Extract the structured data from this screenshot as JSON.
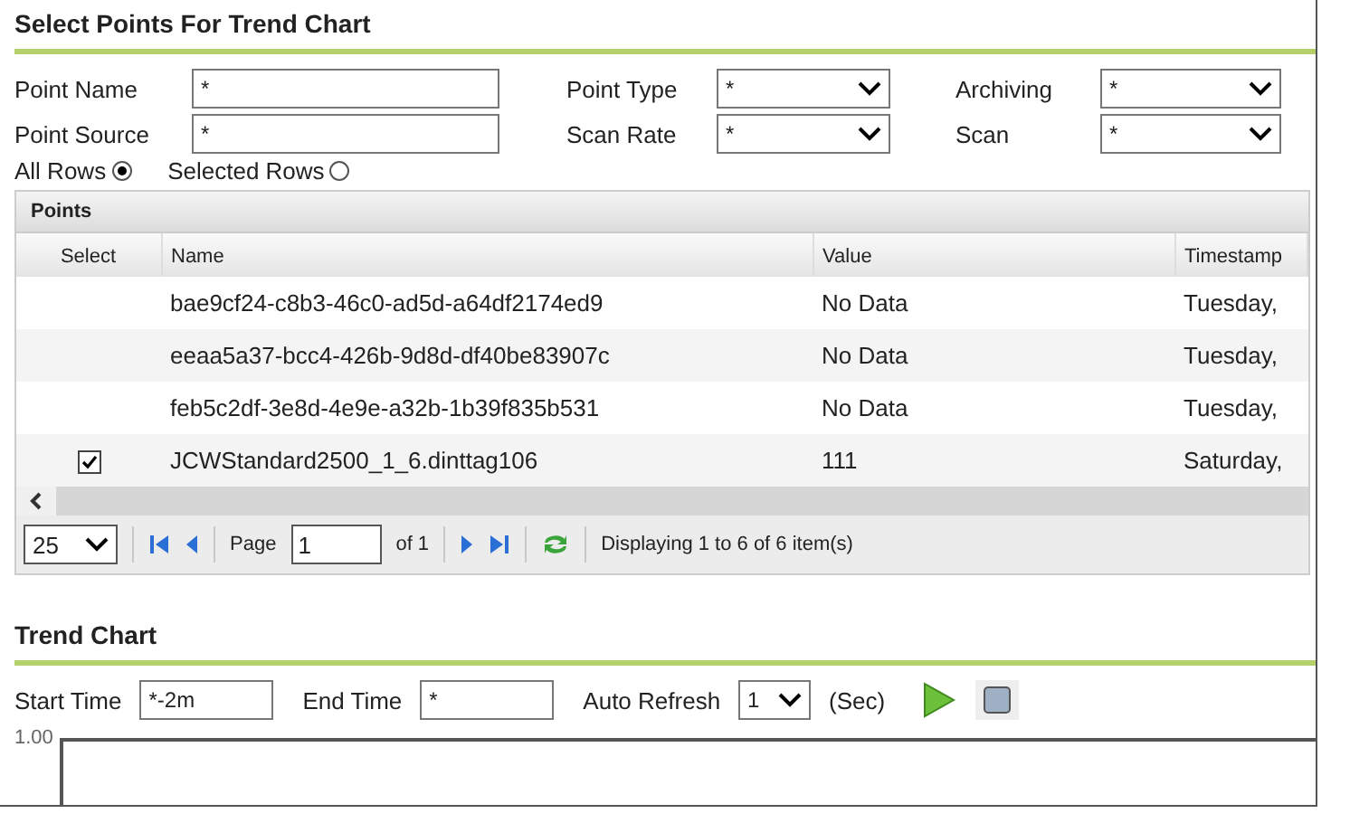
{
  "section_title": "Select Points For Trend Chart",
  "filters": [
    {
      "label": "Point Name",
      "kind": "text",
      "value": "*"
    },
    {
      "label": "Point Type",
      "kind": "select",
      "value": "*"
    },
    {
      "label": "Archiving",
      "kind": "select",
      "value": "*"
    },
    {
      "label": "Point Source",
      "kind": "text",
      "value": "*"
    },
    {
      "label": "Scan Rate",
      "kind": "select",
      "value": "*"
    },
    {
      "label": "Scan",
      "kind": "select",
      "value": "*"
    }
  ],
  "row_scope": [
    {
      "label": "All Rows",
      "selected": true
    },
    {
      "label": "Selected Rows",
      "selected": false
    }
  ],
  "grid": {
    "title": "Points",
    "columns": [
      "Select",
      "Name",
      "Value",
      "Timestamp"
    ],
    "rows": [
      {
        "checked": false,
        "name": "bae9cf24-c8b3-46c0-ad5d-a64df2174ed9",
        "value": "No Data",
        "timestamp": "Tuesday,"
      },
      {
        "checked": false,
        "name": "eeaa5a37-bcc4-426b-9d8d-df40be83907c",
        "value": "No Data",
        "timestamp": "Tuesday,"
      },
      {
        "checked": false,
        "name": "feb5c2df-3e8d-4e9e-a32b-1b39f835b531",
        "value": "No Data",
        "timestamp": "Tuesday,"
      },
      {
        "checked": true,
        "name": "JCWStandard2500_1_6.dinttag106",
        "value": "111",
        "timestamp": "Saturday,"
      }
    ]
  },
  "pager": {
    "page_size": "25",
    "page_label": "Page",
    "page": "1",
    "of_label": "of 1",
    "status": "Displaying 1 to 6 of 6 item(s)"
  },
  "trend": {
    "title": "Trend Chart",
    "start_label": "Start Time",
    "start": "*-2m",
    "end_label": "End Time",
    "end": "*",
    "refresh_label": "Auto Refresh",
    "refresh": "1",
    "unit": "(Sec)",
    "y_tick": "1.00"
  }
}
